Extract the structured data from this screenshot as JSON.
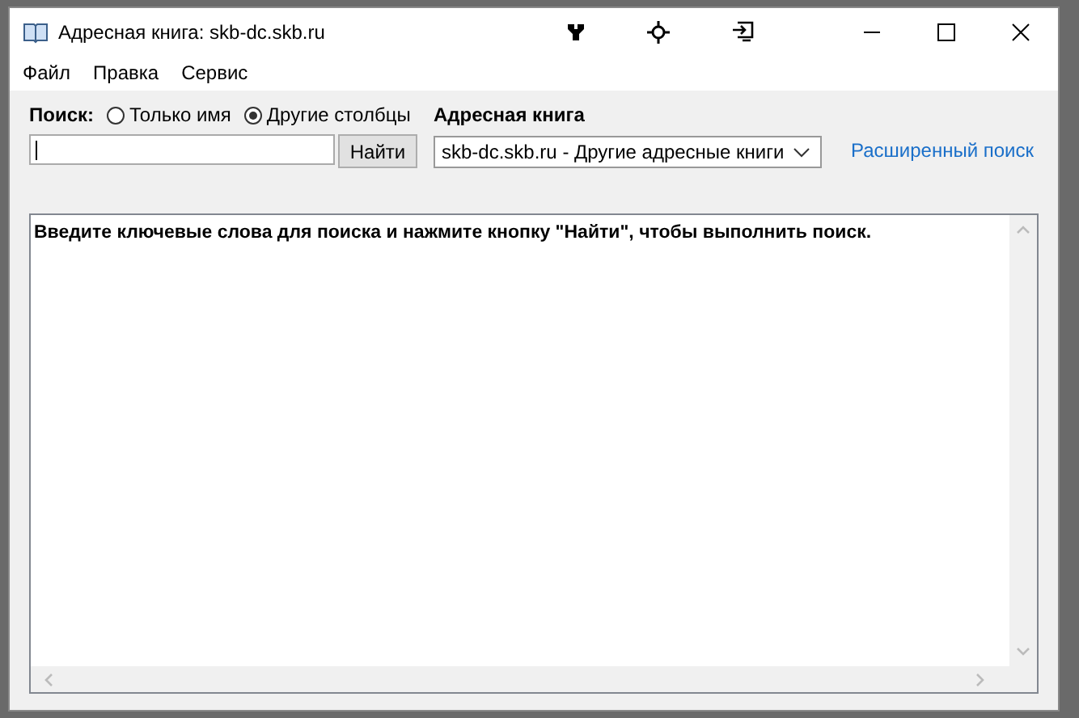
{
  "window": {
    "title": "Адресная книга: skb-dc.skb.ru"
  },
  "menu": [
    "Файл",
    "Правка",
    "Сервис"
  ],
  "search": {
    "label": "Поиск:",
    "options": [
      {
        "label": "Только имя",
        "selected": false
      },
      {
        "label": "Другие столбцы",
        "selected": true
      }
    ],
    "button": "Найти"
  },
  "address_book": {
    "label": "Адресная книга",
    "value": "skb-dc.skb.ru - Другие адресные книги"
  },
  "advanced_search_link": "Расширенный поиск",
  "results": {
    "message": "Введите ключевые слова для поиска и нажмите кнопку \"Найти\", чтобы выполнить поиск."
  }
}
